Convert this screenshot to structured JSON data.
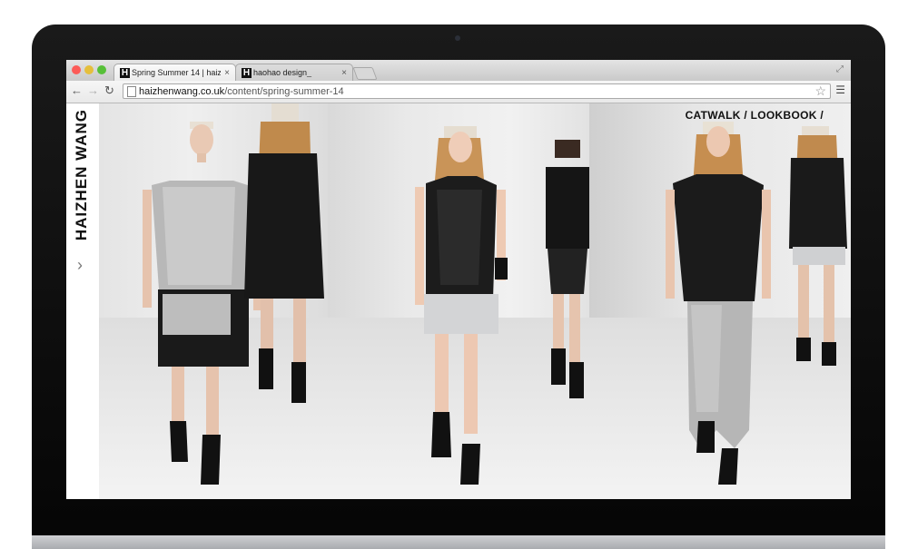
{
  "browser": {
    "tabs": [
      {
        "label": "Spring Summer 14 | haizh",
        "favicon": "H",
        "active": true
      },
      {
        "label": "haohao design_",
        "favicon": "H",
        "active": false
      }
    ],
    "url_domain": "haizhenwang.co.uk",
    "url_path": "/content/spring-summer-14",
    "icons": {
      "back": "back-arrow-icon",
      "forward": "forward-arrow-icon",
      "reload": "reload-icon",
      "bookmark": "star-icon",
      "menu": "menu-icon",
      "close": "close-icon"
    },
    "traffic_lights": [
      "#fc5b57",
      "#e5bf3c",
      "#57c038"
    ]
  },
  "site": {
    "brand": "HAIZHEN WANG",
    "nav": "CATWALK / LOOKBOOK /",
    "arrow": "›"
  },
  "gallery": [
    {
      "description": "model-silver-top-black-skirt"
    },
    {
      "description": "model-black-leather-top-white-shorts"
    },
    {
      "description": "model-black-shirt-grey-trousers"
    }
  ]
}
